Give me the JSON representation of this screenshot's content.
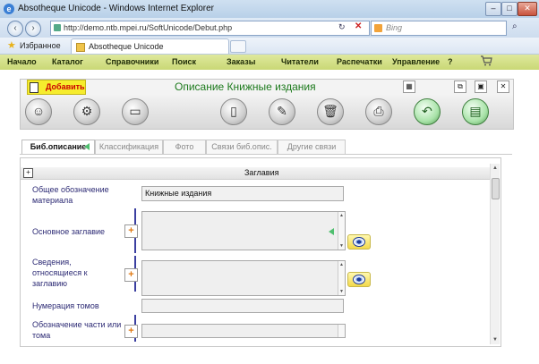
{
  "browser": {
    "title": "Absotheque Unicode - Windows Internet Explorer",
    "window_buttons": [
      "–",
      "□",
      "✕"
    ],
    "url": "http://demo.ntb.mpei.ru/SoftUnicode/Debut.php",
    "search_placeholder": "Bing",
    "favorites_label": "Избранное",
    "tab_label": "Absotheque Unicode"
  },
  "menu": {
    "items": [
      "Начало",
      "Каталог",
      "Справочники",
      "Поиск",
      "Заказы",
      "Читатели",
      "Распечатки",
      "Управление",
      "?"
    ]
  },
  "form": {
    "add_button": "Добавить",
    "title": "Описание Книжные издания",
    "tabs": [
      "Биб.описание",
      "Классификация",
      "Фото",
      "Связи биб.опис.",
      "Другие связи"
    ],
    "active_tab": "Биб.описание",
    "section_title": "Заглавия",
    "fields": {
      "material_label": "Общее обозначение материала",
      "material_value": "Книжные издания",
      "main_title_label": "Основное заглавие",
      "title_info_label": "Сведения, относящиеся к заглавию",
      "volume_num_label": "Нумерация томов",
      "part_label": "Обозначение части или тома"
    }
  },
  "colors": {
    "menu_bg": "#cfdc80",
    "add_button_bg": "#f6ec2d",
    "form_title": "#1d7a1d",
    "label_text": "#2c2a74"
  }
}
